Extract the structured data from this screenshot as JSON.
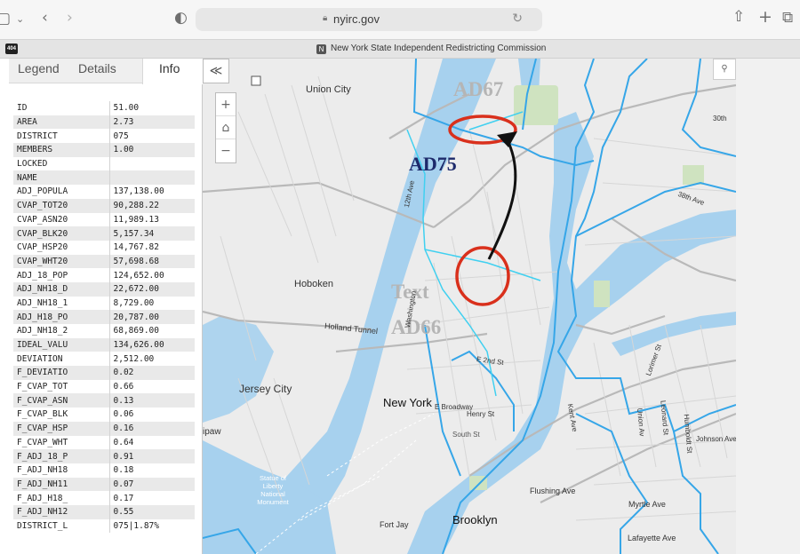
{
  "browser": {
    "url": "nyirc.gov",
    "tab_title": "New York State Independent Redistricting Commission",
    "site_logo": "404",
    "tab_favicon": "N"
  },
  "panel": {
    "tabs": [
      {
        "label": "Legend"
      },
      {
        "label": "Details"
      },
      {
        "label": "Info"
      }
    ],
    "active_tab": "Info",
    "rows": [
      {
        "key": "ID",
        "value": "51.00"
      },
      {
        "key": "AREA",
        "value": "2.73"
      },
      {
        "key": "DISTRICT",
        "value": "075"
      },
      {
        "key": "MEMBERS",
        "value": "1.00"
      },
      {
        "key": "LOCKED",
        "value": ""
      },
      {
        "key": "NAME",
        "value": ""
      },
      {
        "key": "ADJ_POPULA",
        "value": "137,138.00"
      },
      {
        "key": "CVAP_TOT20",
        "value": "90,288.22"
      },
      {
        "key": "CVAP_ASN20",
        "value": "11,989.13"
      },
      {
        "key": "CVAP_BLK20",
        "value": "5,157.34"
      },
      {
        "key": "CVAP_HSP20",
        "value": "14,767.82"
      },
      {
        "key": "CVAP_WHT20",
        "value": "57,698.68"
      },
      {
        "key": "ADJ_18_POP",
        "value": "124,652.00"
      },
      {
        "key": "ADJ_NH18_D",
        "value": "22,672.00"
      },
      {
        "key": "ADJ_NH18_1",
        "value": "8,729.00"
      },
      {
        "key": "ADJ_H18_PO",
        "value": "20,787.00"
      },
      {
        "key": "ADJ_NH18_2",
        "value": "68,869.00"
      },
      {
        "key": "IDEAL_VALU",
        "value": "134,626.00"
      },
      {
        "key": "DEVIATION",
        "value": "2,512.00"
      },
      {
        "key": "F_DEVIATIO",
        "value": "0.02"
      },
      {
        "key": "F_CVAP_TOT",
        "value": "0.66"
      },
      {
        "key": "F_CVAP_ASN",
        "value": "0.13"
      },
      {
        "key": "F_CVAP_BLK",
        "value": "0.06"
      },
      {
        "key": "F_CVAP_HSP",
        "value": "0.16"
      },
      {
        "key": "F_CVAP_WHT",
        "value": "0.64"
      },
      {
        "key": "F_ADJ_18_P",
        "value": "0.91"
      },
      {
        "key": "F_ADJ_NH18",
        "value": "0.18"
      },
      {
        "key": "F_ADJ_NH11",
        "value": "0.07"
      },
      {
        "key": "F_ADJ_H18_",
        "value": "0.17"
      },
      {
        "key": "F_ADJ_NH12",
        "value": "0.55"
      },
      {
        "key": "DISTRICT_L",
        "value": "075|1.87%"
      }
    ]
  },
  "map": {
    "district_labels": {
      "ad67": "AD67",
      "ad75": "AD75",
      "ad66": "AD66",
      "text": "Text"
    },
    "place_labels": {
      "union_city": "Union City",
      "hoboken": "Hoboken",
      "jersey_city": "Jersey City",
      "new_york": "New York",
      "brooklyn": "Brooklyn",
      "fort_jay": "Fort Jay",
      "statue": "Statue of Liberty National Monument",
      "holland_tunnel": "Holland Tunnel",
      "twelfth_ave": "12th Ave",
      "washington": "Washington",
      "e_broadway": "E Broadway",
      "henry_st": "Henry St",
      "south_st": "South St",
      "flushing_ave": "Flushing Ave",
      "myrtle_ave": "Myrtle Ave",
      "lafayette_ave": "Lafayette Ave",
      "johnson_ave": "Johnson Ave",
      "ipaw": "ipaw",
      "kent_ave": "Kent Ave",
      "union_av": "Union Av",
      "leonard_st": "Leonard St",
      "humboldt_st": "Humboldt St",
      "lorimer_st": "Lorimer St",
      "e_2nd_st": "E 2nd St",
      "thirty_eighth_ave": "38th Ave",
      "thirtieth": "30th"
    },
    "colors": {
      "water": "#a7d1ee",
      "land": "#ececec",
      "district_line": "#36a6e8",
      "highlight_line": "#40d0f0",
      "ellipse": "#d9301c",
      "arrow": "#111111"
    }
  }
}
